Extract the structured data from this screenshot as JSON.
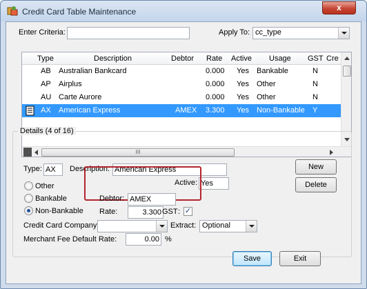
{
  "window": {
    "title": "Credit Card Table Maintenance",
    "close_label": "x"
  },
  "criteria": {
    "enter_label": "Enter Criteria:",
    "enter_value": "",
    "apply_label": "Apply To:",
    "apply_value": "cc_type"
  },
  "grid": {
    "columns": [
      "Type",
      "Description",
      "Debtor",
      "Rate",
      "Active",
      "Usage",
      "GST",
      "Cre"
    ],
    "rows": [
      {
        "type": "AB",
        "description": "Australian Bankcard",
        "debtor": "",
        "rate": "0.000",
        "active": "Yes",
        "usage": "Bankable",
        "gst": "N"
      },
      {
        "type": "AP",
        "description": "Airplus",
        "debtor": "",
        "rate": "0.000",
        "active": "Yes",
        "usage": "Other",
        "gst": "N"
      },
      {
        "type": "AU",
        "description": "Carte Aurore",
        "debtor": "",
        "rate": "0.000",
        "active": "Yes",
        "usage": "Other",
        "gst": "N"
      },
      {
        "type": "AX",
        "description": "American Express",
        "debtor": "AMEX",
        "rate": "3.300",
        "active": "Yes",
        "usage": "Non-Bankable",
        "gst": "Y"
      }
    ],
    "scroll_grip": "III"
  },
  "details": {
    "legend": "Details (4 of 16)",
    "type_label": "Type:",
    "type_value": "AX",
    "description_label": "Description:",
    "description_value": "American Express",
    "active_label": "Active:",
    "active_value": "Yes",
    "usage_options": [
      "Other",
      "Bankable",
      "Non-Bankable"
    ],
    "usage_selected": "Non-Bankable",
    "debtor_label": "Debtor:",
    "debtor_value": "AMEX",
    "rate_label": "Rate:",
    "rate_value": "3.300",
    "gst_label": "GST",
    "gst_colon": ":",
    "gst_check": "✓",
    "cc_company_label": "Credit Card Company:",
    "cc_company_value": "",
    "extract_label": "Extract:",
    "extract_value": "Optional",
    "merchant_fee_label": "Merchant Fee Default Rate:",
    "merchant_fee_value": "0.00",
    "merchant_fee_unit": "%"
  },
  "buttons": {
    "new": "New",
    "delete": "Delete",
    "save": "Save",
    "exit": "Exit"
  }
}
